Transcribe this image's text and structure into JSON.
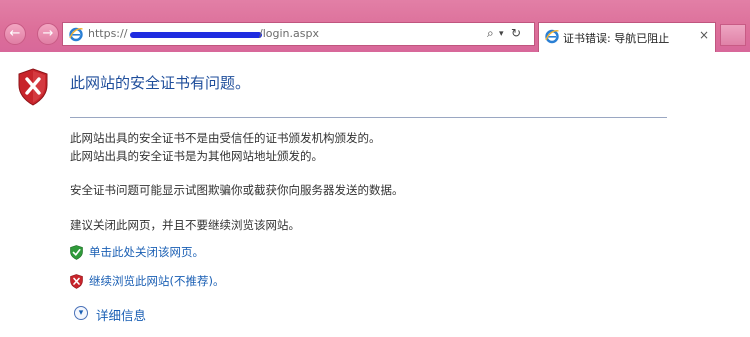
{
  "browser": {
    "url_prefix": "https://",
    "url_suffix": "/login.aspx",
    "back_glyph": "←",
    "forward_glyph": "→",
    "search_glyph": "⌕",
    "refresh_glyph": "↻",
    "dropdown_glyph": "▾",
    "close_glyph": "×",
    "tab_title": "证书错误: 导航已阻止"
  },
  "page": {
    "title": "此网站的安全证书有问题。",
    "line1": "此网站出具的安全证书不是由受信任的证书颁发机构颁发的。",
    "line2": "此网站出具的安全证书是为其他网站地址颁发的。",
    "line3": "安全证书问题可能显示试图欺骗你或截获你向服务器发送的数据。",
    "line4": "建议关闭此网页，并且不要继续浏览该网站。",
    "close_link": "单击此处关闭该网页。",
    "continue_link": "继续浏览此网站(不推荐)。",
    "details_label": "详细信息",
    "details_glyph": "▾"
  },
  "colors": {
    "chrome_pink": "#dc6e99",
    "title_blue": "#1f4e9b",
    "link_blue": "#1a5fb4",
    "shield_red": "#c8242b",
    "shield_green": "#2f9a3a"
  }
}
